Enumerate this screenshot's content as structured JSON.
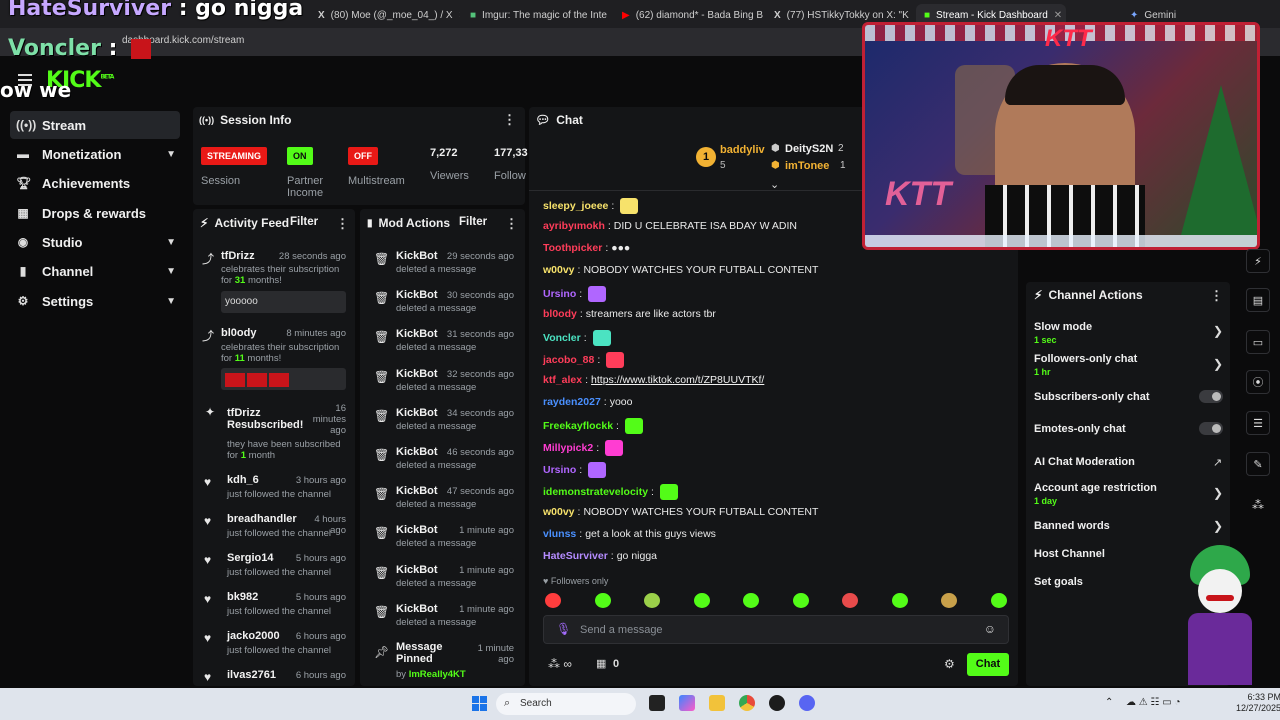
{
  "overlay": {
    "top_user": "HateSurviver",
    "top_sep": " : ",
    "top_msg": "go nigga",
    "second_user": "Voncler",
    "second_sep": " : ",
    "third_text": "ow we"
  },
  "browser": {
    "tabs": [
      {
        "label": "(80) Moe (@_moe_04_) / X"
      },
      {
        "label": "Imgur: The magic of the Inte"
      },
      {
        "label": "(62) diamond* - Bada Bing B"
      },
      {
        "label": "(77) HSTikkyTokky on X: \"K"
      },
      {
        "label": "Stream - Kick Dashboard"
      },
      {
        "label": "Gemini"
      }
    ],
    "url": "dashboard.kick.com/stream"
  },
  "header": {
    "logo": "KICK",
    "logo_suffix": "BETA"
  },
  "sidebar": {
    "items": [
      {
        "label": "Stream",
        "icon": "signal-icon"
      },
      {
        "label": "Monetization",
        "icon": "money-icon"
      },
      {
        "label": "Achievements",
        "icon": "trophy-icon"
      },
      {
        "label": "Drops & rewards",
        "icon": "gift-icon"
      },
      {
        "label": "Studio",
        "icon": "globe-icon"
      },
      {
        "label": "Channel",
        "icon": "chart-icon"
      },
      {
        "label": "Settings",
        "icon": "gear-icon"
      }
    ]
  },
  "session": {
    "title": "Session Info",
    "status_streaming": "STREAMING",
    "status_on": "ON",
    "status_off": "OFF",
    "label_session": "Session",
    "label_partner": "Partner Income",
    "label_multistream": "Multistream",
    "viewers_value": "7,272",
    "viewers_label": "Viewers",
    "followers_value": "177,33",
    "followers_label": "Follow"
  },
  "activity": {
    "title": "Activity Feed",
    "filter": "Filter",
    "items": [
      {
        "name": "tfDrizz",
        "time": "28 seconds ago",
        "pre": "celebrates their subscription for ",
        "num": "31",
        "post": " months!",
        "box": "yooooo"
      },
      {
        "name": "bl0ody",
        "time": "8 minutes ago",
        "pre": "celebrates their subscription for ",
        "num": "11",
        "post": " months!",
        "box": ""
      },
      {
        "name": "tfDrizz",
        "sub": "Resubscribed!",
        "time1": "16",
        "time2": "minutes",
        "time3": "ago",
        "pre": "they have been subscribed for ",
        "num": "1",
        "post": " month"
      },
      {
        "name": "kdh_6",
        "time": "3 hours ago",
        "desc": "just followed the channel"
      },
      {
        "name": "breadhandler",
        "time": "4 hours ago",
        "desc": "just followed the channel"
      },
      {
        "name": "Sergio14",
        "time": "5 hours ago",
        "desc": "just followed the channel"
      },
      {
        "name": "bk982",
        "time": "5 hours ago",
        "desc": "just followed the channel"
      },
      {
        "name": "jacko2000",
        "time": "6 hours ago",
        "desc": "just followed the channel"
      },
      {
        "name": "ilvas2761",
        "time": "6 hours ago",
        "desc": ""
      }
    ]
  },
  "mod": {
    "title": "Mod Actions",
    "filter": "Filter",
    "items": [
      {
        "name": "KickBot",
        "time": "29 seconds ago",
        "desc": "deleted a message"
      },
      {
        "name": "KickBot",
        "time": "30 seconds ago",
        "desc": "deleted a message"
      },
      {
        "name": "KickBot",
        "time": "31 seconds ago",
        "desc": "deleted a message"
      },
      {
        "name": "KickBot",
        "time": "32 seconds ago",
        "desc": "deleted a message"
      },
      {
        "name": "KickBot",
        "time": "34 seconds ago",
        "desc": "deleted a message"
      },
      {
        "name": "KickBot",
        "time": "46 seconds ago",
        "desc": "deleted a message"
      },
      {
        "name": "KickBot",
        "time": "47 seconds ago",
        "desc": "deleted a message"
      },
      {
        "name": "KickBot",
        "time": "1 minute ago",
        "desc": "deleted a message"
      },
      {
        "name": "KickBot",
        "time": "1 minute ago",
        "desc": "deleted a message"
      },
      {
        "name": "KickBot",
        "time": "1 minute ago",
        "desc": "deleted a message"
      }
    ],
    "pinned_title": "Message Pinned",
    "pinned_time1": "1 minute",
    "pinned_time2": "ago",
    "pinned_by_pre": "by ",
    "pinned_by": "ImReally4KT"
  },
  "chat": {
    "title": "Chat",
    "leader1_rank": "1",
    "leader1_name": "baddyliv",
    "leader1_count": "5",
    "leader2_name": "DeityS2N",
    "leader2_count": "2",
    "leader3_name": "imTonee",
    "leader3_count": "1",
    "messages": [
      {
        "user": "sleepy_joeee",
        "sep": ":",
        "text": "",
        "color": "#f7e26b"
      },
      {
        "user": "ayribyımokh",
        "sep": ":",
        "text": "DID U CELEBRATE ISA BDAY W ADIN",
        "color": "#ff3d5a"
      },
      {
        "user": "Toothpicker",
        "sep": ":",
        "text": "●●●",
        "color": "#ff3d5a"
      },
      {
        "user": "w00vy",
        "sep": ":",
        "text": "NOBODY WATCHES YOUR FUTBALL CONTENT",
        "color": "#f7e26b"
      },
      {
        "user": "Ursino",
        "sep": ":",
        "text": "",
        "color": "#b066ff"
      },
      {
        "user": "bl0ody",
        "sep": ":",
        "text": "streamers are like actors tbr",
        "color": "#ff3d5a"
      },
      {
        "user": "Voncler",
        "sep": ":",
        "text": "",
        "color": "#4be3c2"
      },
      {
        "user": "jacobo_88",
        "sep": ":",
        "text": "",
        "color": "#ff3d5a"
      },
      {
        "user": "ktf_alex",
        "sep": ":",
        "text": "https://www.tiktok.com/t/ZP8UUVTKf/",
        "color": "#ff3d5a"
      },
      {
        "user": "rayden2027",
        "sep": ":",
        "text": "yooo",
        "color": "#4a90ff"
      },
      {
        "user": "Freekayflockk",
        "sep": ":",
        "text": "",
        "color": "#53fc18"
      },
      {
        "user": "Millypick2",
        "sep": ":",
        "text": "",
        "color": "#ff3dd2"
      },
      {
        "user": "Ursino",
        "sep": ":",
        "text": "",
        "color": "#b066ff"
      },
      {
        "user": "idemonstratevelocity",
        "sep": ":",
        "text": "",
        "color": "#53fc18"
      },
      {
        "user": "w00vy",
        "sep": ":",
        "text": "NOBODY WATCHES YOUR FUTBALL CONTENT",
        "color": "#f7e26b"
      },
      {
        "user": "vlunss",
        "sep": ":",
        "text": "get a look at this guys views",
        "color": "#4a90ff"
      },
      {
        "user": "HateSurviver",
        "sep": ":",
        "text": "go nigga",
        "color": "#b58cff"
      }
    ],
    "followers_only": "Followers only",
    "input_placeholder": "Send a message",
    "points": "0",
    "send_label": "Chat",
    "emote_colors": [
      "#ff3d3d",
      "#53fc18",
      "#9bd04a",
      "#53fc18",
      "#53fc18",
      "#53fc18",
      "#e84b4b",
      "#53fc18",
      "#c8a04a",
      "#53fc18"
    ]
  },
  "channel_actions": {
    "title": "Channel Actions",
    "slow_mode": "Slow mode",
    "slow_mode_val": "1 sec",
    "followers_only": "Followers-only chat",
    "followers_only_val": "1 hr",
    "subscribers_only": "Subscribers-only chat",
    "emotes_only": "Emotes-only chat",
    "ai_mod": "AI Chat Moderation",
    "age_restriction": "Account age restriction",
    "age_restriction_val": "1 day",
    "banned_words": "Banned words",
    "host_channel": "Host Channel",
    "set_goals": "Set goals"
  },
  "taskbar": {
    "search": "Search",
    "time": "6:33 PM",
    "date": "12/27/2025"
  },
  "colors": {
    "accent": "#53fc18",
    "streaming": "#e91916",
    "off": "#e91916",
    "panel": "#141517"
  },
  "webcam": {
    "watermark": "KTT"
  }
}
